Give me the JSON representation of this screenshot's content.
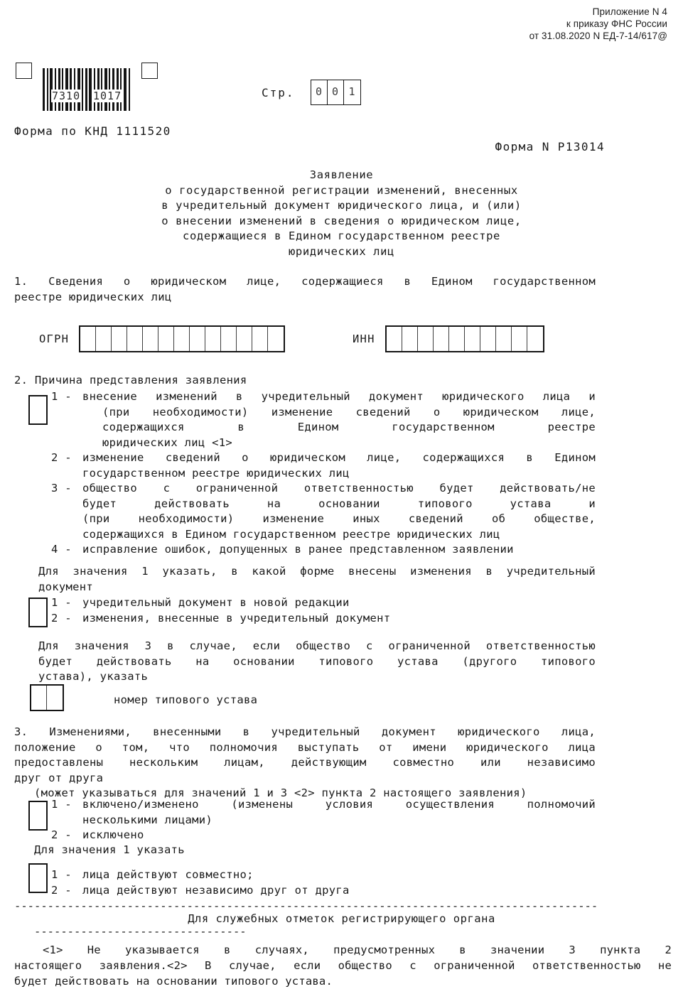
{
  "appendix": {
    "line1": "Приложение N 4",
    "line2": "к приказу ФНС России",
    "line3": "от 31.08.2020 N ЕД-7-14/617@"
  },
  "barcode": {
    "digits_left": "7310",
    "digits_right": "1017"
  },
  "page_number": {
    "label": "Стр.",
    "digits": [
      "0",
      "0",
      "1"
    ]
  },
  "knd_line": "Форма по КНД 1111520",
  "form_number": "Форма N Р13014",
  "title": {
    "line1": "Заявление",
    "line2": "о государственной регистрации изменений, внесенных",
    "line3": "в учредительный документ юридического лица, и (или)",
    "line4": "о внесении изменений в сведения о юридическом лице,",
    "line5": "содержащиеся в Едином государственном реестре",
    "line6": "юридических лиц"
  },
  "section1": {
    "line1": "1. Сведения о юридическом лице, содержащиеся в Едином государственном",
    "line2": "реестре  юридических лиц",
    "ogrn_label": "ОГРН",
    "ogrn_cells": 13,
    "inn_label": "ИНН",
    "inn_cells": 10
  },
  "section2": {
    "heading": "2. Причина представления заявления",
    "options": [
      {
        "num": "1 -",
        "lines": [
          "внесение изменений в учредительный документ  юридического   лица и",
          "(при  необходимости)  изменение  сведений  о   юридическом   лице,",
          "содержащихся      в      Едином      государственном      реестре",
          "юридических лиц <1>"
        ]
      },
      {
        "num": "2 -",
        "lines": [
          "изменение сведений о  юридическом  лице,  содержащихся  в  Едином",
          "государственном реестре юридических лиц"
        ]
      },
      {
        "num": "3 -",
        "lines": [
          "общество с  ограниченной  ответственностью  будет  действовать/не",
          "будет   действовать     на     основании     типового     устава     и",
          "(при   необходимости)   изменение   иных   сведений   об   обществе,",
          "содержащихся в Едином государственном реестре юридических лиц"
        ]
      },
      {
        "num": "4 -",
        "lines": [
          "исправление ошибок, допущенных в ранее представленном заявлении"
        ]
      }
    ],
    "sub1_intro_line1": "Для значения 1 указать, в какой форме внесены изменения в учредительный",
    "sub1_intro_line2": "документ",
    "sub1_options": [
      {
        "num": "1 -",
        "text": "учредительный документ в новой редакции"
      },
      {
        "num": "2 -",
        "text": "изменения, внесенные в учредительный документ"
      }
    ],
    "sub3_intro_line1": "Для значения 3 в случае, если общество с ограниченной  ответственностью",
    "sub3_intro_line2": "будет  действовать   на   основании   типового   устава   (другого   типового",
    "sub3_intro_line3": "устава), указать",
    "charter_number_label": "номер типового устава",
    "charter_number_cells": 2
  },
  "section3": {
    "line1": "3. Изменениями, внесенными в  учредительный  документ  юридического    лица,",
    "line2": "положение о том, что полномочия выступать   от   имени   юридического   лица",
    "line3": "предоставлены нескольким лицам,   действующим   совместно   или   независимо",
    "line4": "друг от друга",
    "note": "(может указываться для значений 1 и 3 <2> пункта 2 настоящего заявления)",
    "options": [
      {
        "num": "1 -",
        "lines": [
          "включено/изменено  (изменены  условия  осуществления      полномочий",
          "несколькими лицами)"
        ]
      },
      {
        "num": "2 -",
        "lines": [
          "исключено"
        ]
      }
    ],
    "sub_intro": "Для значения 1 указать",
    "sub_options": [
      {
        "num": "1 -",
        "text": "лица действуют совместно;"
      },
      {
        "num": "2 -",
        "text": "лица действуют независимо друг от друга"
      }
    ]
  },
  "service_section": {
    "title": "Для служебных отметок регистрирующего органа"
  },
  "footnotes": {
    "line1": "<1> Не  указывается  в  случаях, предусмотренных в значении 3 пункта  2",
    "line2": "настоящего заявления.<2> В  случае,   если общество с ограниченной ответственностью не",
    "line3": "будет действовать на основании типового устава."
  }
}
